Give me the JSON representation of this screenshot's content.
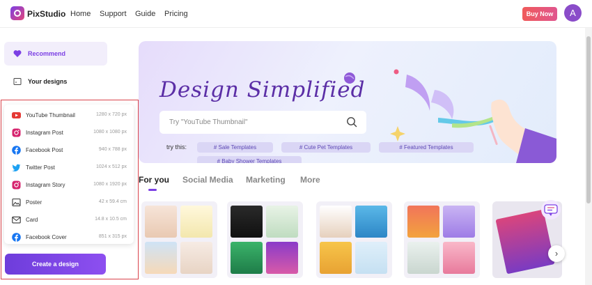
{
  "header": {
    "brand": "PixStudio",
    "nav": [
      "Home",
      "Support",
      "Guide",
      "Pricing"
    ],
    "buy_label": "Buy Now",
    "avatar_initial": "A"
  },
  "sidebar": {
    "items": [
      {
        "label": "Recommend",
        "icon": "heart-icon",
        "active": true
      },
      {
        "label": "Your designs",
        "icon": "folder-icon",
        "active": false
      }
    ],
    "create_label": "Create a design"
  },
  "popup": {
    "items": [
      {
        "label": "YouTube Thumbnail",
        "size": "1280 x 720 px",
        "icon": "youtube-icon",
        "color": "#e53935"
      },
      {
        "label": "Instagram Post",
        "size": "1080 x 1080 px",
        "icon": "instagram-icon",
        "color": "#d6246e"
      },
      {
        "label": "Facebook Post",
        "size": "940 x 788 px",
        "icon": "facebook-icon",
        "color": "#1877f2"
      },
      {
        "label": "Twitter Post",
        "size": "1024 x 512 px",
        "icon": "twitter-icon",
        "color": "#1da1f2"
      },
      {
        "label": "Instagram Story",
        "size": "1080 x 1920 px",
        "icon": "instagram-icon",
        "color": "#d6246e"
      },
      {
        "label": "Poster",
        "size": "42 x 59.4 cm",
        "icon": "image-icon",
        "color": "#333333"
      },
      {
        "label": "Card",
        "size": "14.8 x 10.5 cm",
        "icon": "envelope-icon",
        "color": "#333333"
      },
      {
        "label": "Facebook Cover",
        "size": "851 x 315 px",
        "icon": "facebook-icon",
        "color": "#1877f2"
      }
    ]
  },
  "hero": {
    "title": "Design Simplified",
    "search_placeholder": "Try \"YouTube Thumbnail\"",
    "try_label": "try this:",
    "chips": [
      "# Sale Templates",
      "# Cute Pet Templates",
      "# Featured Templates",
      "# Baby Shower Templates"
    ]
  },
  "tabs": [
    "For you",
    "Social Media",
    "Marketing",
    "More"
  ],
  "colors": {
    "accent": "#7b3fe4",
    "highlight_border": "#d9434b",
    "buy": "#ef5b6b"
  }
}
